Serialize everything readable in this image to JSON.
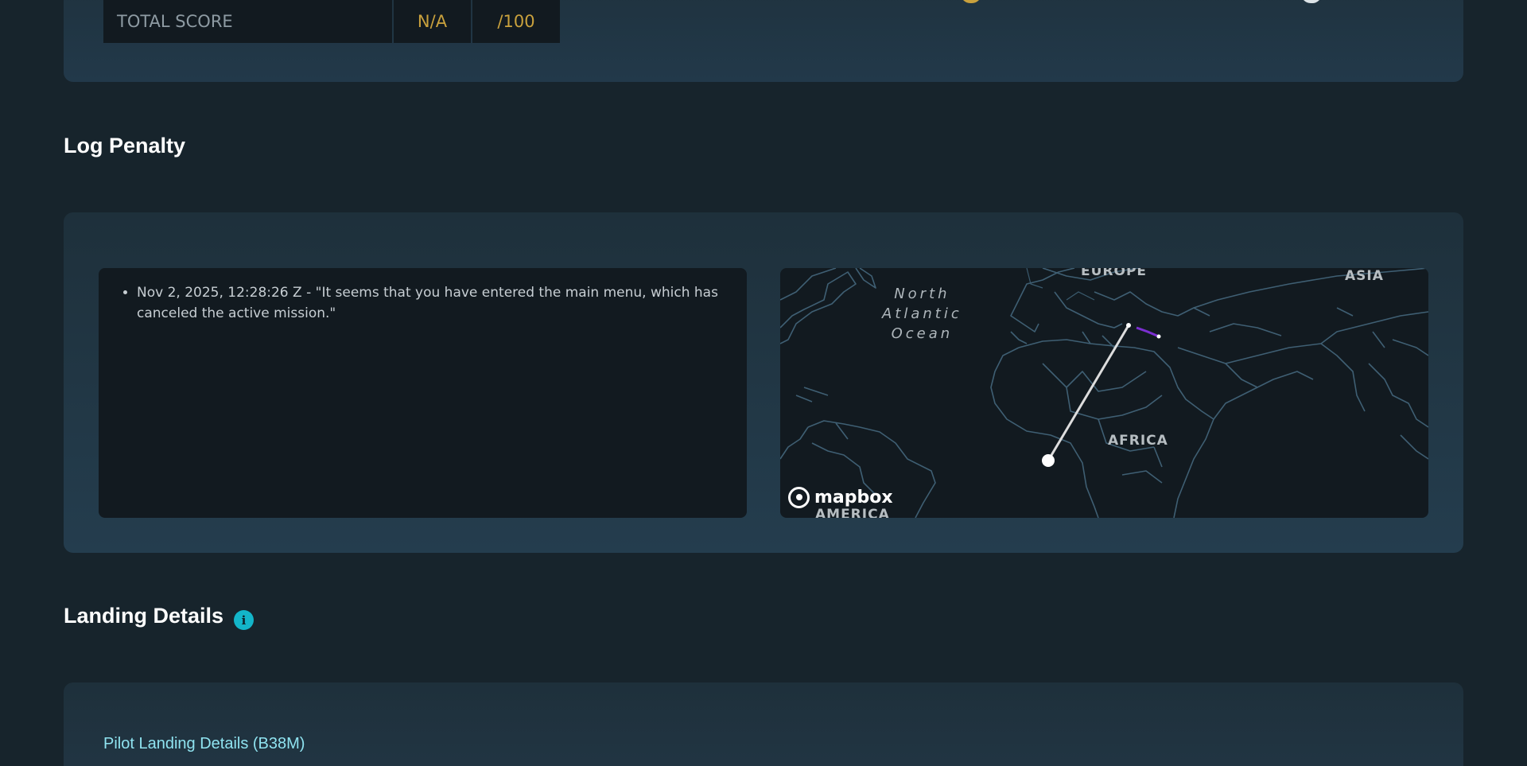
{
  "score": {
    "label": "TOTAL SCORE",
    "value": "N/A",
    "max": "/100"
  },
  "log_penalty": {
    "title": "Log Penalty",
    "entries": [
      "Nov 2, 2025, 12:28:26 Z - \"It seems that you have entered the main menu, which has canceled the active mission.\""
    ]
  },
  "map": {
    "ocean_label": [
      "North",
      "Atlantic",
      "Ocean"
    ],
    "continents": {
      "europe": "EUROPE",
      "asia": "ASIA",
      "africa": "AFRICA",
      "america": "AMERICA"
    },
    "attribution": "mapbox",
    "route_color": "#dddddd",
    "track_color": "#7b2fd0"
  },
  "landing": {
    "title": "Landing Details",
    "info_icon": "i",
    "subtitle": "Pilot Landing Details (B38M)"
  },
  "colors": {
    "background": "#17242c",
    "panel": "#1e303b",
    "accent_gold": "#c9a13d",
    "accent_cyan": "#13b5c9"
  }
}
